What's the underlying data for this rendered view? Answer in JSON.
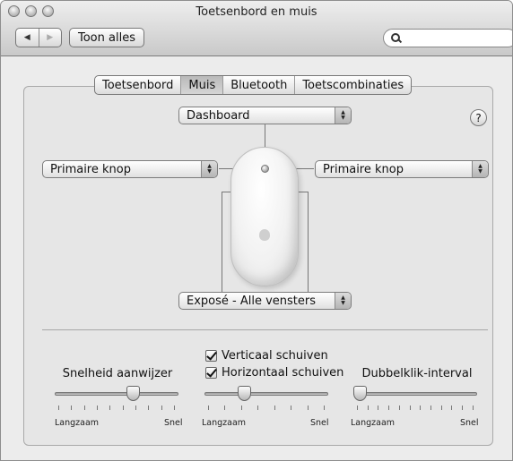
{
  "window": {
    "title": "Toetsenbord en muis"
  },
  "toolbar": {
    "back": "◀",
    "forward": "▶",
    "show_all": "Toon alles",
    "search_placeholder": ""
  },
  "tabs": [
    {
      "label": "Toetsenbord",
      "active": false
    },
    {
      "label": "Muis",
      "active": true
    },
    {
      "label": "Bluetooth",
      "active": false
    },
    {
      "label": "Toetscombinaties",
      "active": false
    }
  ],
  "mouse": {
    "top_button": "Dashboard",
    "left_button": "Primaire knop",
    "right_button": "Primaire knop",
    "bottom_button": "Exposé - Alle vensters"
  },
  "help": "?",
  "scroll": {
    "vertical": "Verticaal schuiven",
    "vertical_checked": true,
    "horizontal": "Horizontaal schuiven",
    "horizontal_checked": true
  },
  "sliders": [
    {
      "label": "Snelheid aanwijzer",
      "min_label": "Langzaam",
      "max_label": "Snel",
      "value": 0.65
    },
    {
      "label": "",
      "min_label": "Langzaam",
      "max_label": "Snel",
      "value": 0.3
    },
    {
      "label": "Dubbelklik-interval",
      "min_label": "Langzaam",
      "max_label": "Snel",
      "value": 0.0
    }
  ]
}
